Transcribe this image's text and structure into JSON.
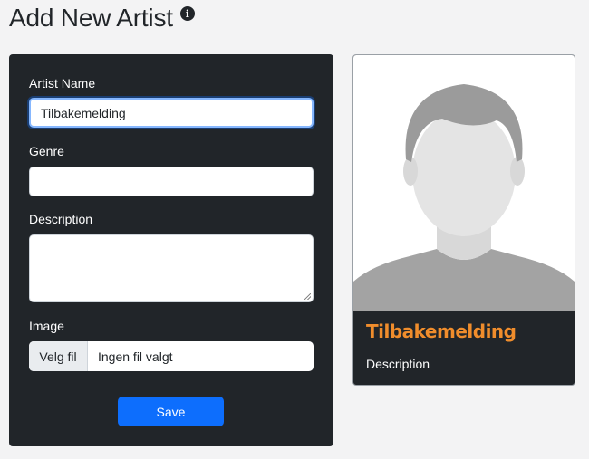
{
  "header": {
    "title": "Add New Artist",
    "info_icon": "info-icon"
  },
  "form": {
    "artist_name_label": "Artist Name",
    "artist_name_value": "Tilbakemelding",
    "genre_label": "Genre",
    "genre_value": "",
    "description_label": "Description",
    "description_value": "",
    "image_label": "Image",
    "file_button_label": "Velg fil",
    "file_status": "Ingen fil valgt",
    "save_label": "Save"
  },
  "preview": {
    "name": "Tilbakemelding",
    "description": "Description",
    "avatar_icon": "person-silhouette-icon"
  },
  "colors": {
    "card_bg": "#212529",
    "primary": "#0d6efd",
    "preview_name": "#f08d2c",
    "page_bg": "#f3f3f4"
  }
}
